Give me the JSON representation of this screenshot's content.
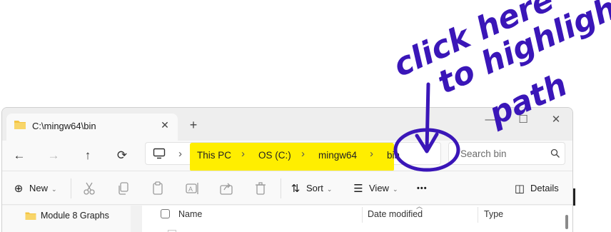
{
  "tab": {
    "title": "C:\\mingw64\\bin",
    "close_glyph": "✕",
    "new_tab_glyph": "+"
  },
  "window_controls": {
    "minimize": "—",
    "maximize": "☐",
    "close": "✕"
  },
  "nav": {
    "back": "←",
    "forward": "→",
    "up": "↑",
    "refresh": "⟳"
  },
  "breadcrumb": [
    "This PC",
    "OS (C:)",
    "mingw64",
    "bin"
  ],
  "breadcrumb_sep": "›",
  "search": {
    "placeholder": "Search bin"
  },
  "commands": {
    "new_label": "New",
    "sort_label": "Sort",
    "view_label": "View",
    "more_label": "•••",
    "details_label": "Details"
  },
  "nav_pane": {
    "items": [
      {
        "label": "Module 8 Graphs"
      }
    ]
  },
  "file_list": {
    "columns": [
      "Name",
      "Date modified",
      "Type"
    ]
  },
  "annotation": {
    "text_lines": [
      "click here",
      "to highlight",
      "path"
    ],
    "ink_color": "#3a16b8",
    "highlight_color": "#ffee00"
  }
}
